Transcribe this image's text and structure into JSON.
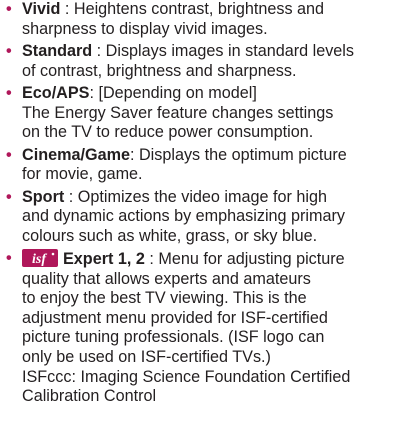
{
  "items": [
    {
      "term": "Vivid",
      "separator": " : ",
      "lines": [
        "Heightens contrast, brightness and",
        "sharpness to display vivid images."
      ]
    },
    {
      "term": "Standard",
      "separator": " : ",
      "lines": [
        "Displays images in standard levels",
        "of contrast, brightness and sharpness."
      ]
    },
    {
      "term": "Eco/APS",
      "separator": ": ",
      "lines": [
        "[Depending on model]",
        "The Energy Saver feature changes settings",
        "on the TV to reduce power consumption."
      ]
    },
    {
      "term": "Cinema/Game",
      "separator": ": ",
      "lines": [
        "Displays the optimum picture",
        "for movie, game."
      ]
    },
    {
      "term": "Sport",
      "separator": " : ",
      "lines": [
        "Optimizes the video image for high",
        "and dynamic actions by emphasizing primary",
        "colours such as white, grass, or sky blue."
      ]
    },
    {
      "logo_text": "isf",
      "term": "Expert 1, 2",
      "separator": " : ",
      "lines": [
        "Menu for adjusting picture",
        "quality that allows experts and amateurs",
        "to enjoy the best TV viewing. This is the",
        "adjustment menu provided for ISF-certified",
        "picture tuning professionals. (ISF logo can",
        "only be used on ISF-certified TVs.)",
        "ISFccc: Imaging Science Foundation Certified",
        "Calibration Control"
      ]
    }
  ],
  "colors": {
    "bullet": "#b0175a",
    "text": "#231f20",
    "logo_bg": "#b0175a"
  },
  "icons": {
    "bullet": "•",
    "logo": "isf-logo-icon"
  }
}
